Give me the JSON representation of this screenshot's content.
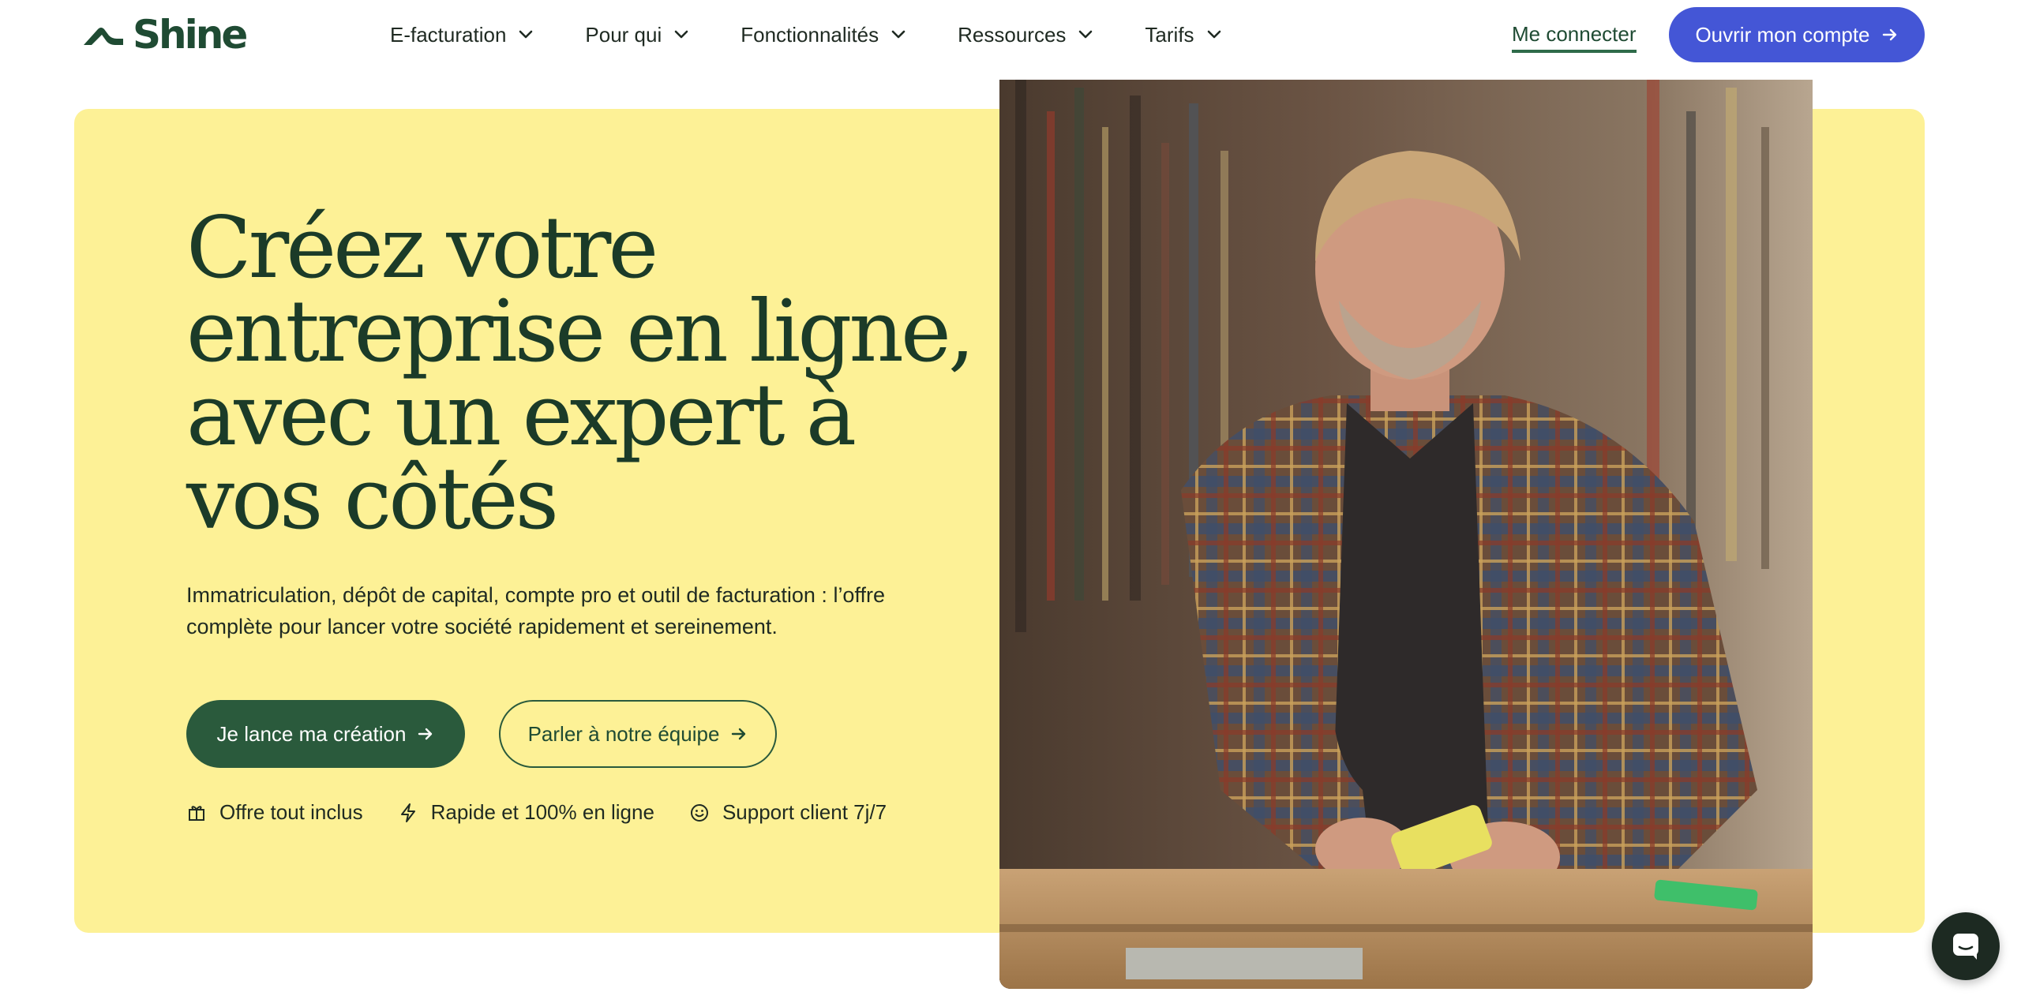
{
  "brand": {
    "name": "Shine",
    "color": "#1f4b33"
  },
  "nav": {
    "items": [
      {
        "label": "E-facturation"
      },
      {
        "label": "Pour qui"
      },
      {
        "label": "Fonctionnalités"
      },
      {
        "label": "Ressources"
      },
      {
        "label": "Tarifs"
      }
    ],
    "login_label": "Me connecter",
    "cta_label": "Ouvrir mon compte"
  },
  "hero": {
    "title": "Créez votre entreprise en ligne, avec un expert à vos côtés",
    "subtitle": "Immatriculation, dépôt de capital, compte pro et outil de facturation : l’offre complète pour lancer votre société rapidement et sereinement.",
    "primary_cta": "Je lance ma création",
    "secondary_cta": "Parler à notre équipe",
    "features": [
      {
        "icon": "gift-icon",
        "label": "Offre tout inclus"
      },
      {
        "icon": "lightning-icon",
        "label": "Rapide et 100% en ligne"
      },
      {
        "icon": "smiley-icon",
        "label": "Support client 7j/7"
      }
    ]
  },
  "colors": {
    "hero_background": "#fdf196",
    "primary_green": "#2a5a3c",
    "title_green": "#1b3b28",
    "accent_blue": "#4456d6",
    "chat_bubble": "#1d2a22"
  },
  "icons": [
    "chevron-down-icon",
    "arrow-right-icon",
    "chat-icon"
  ]
}
